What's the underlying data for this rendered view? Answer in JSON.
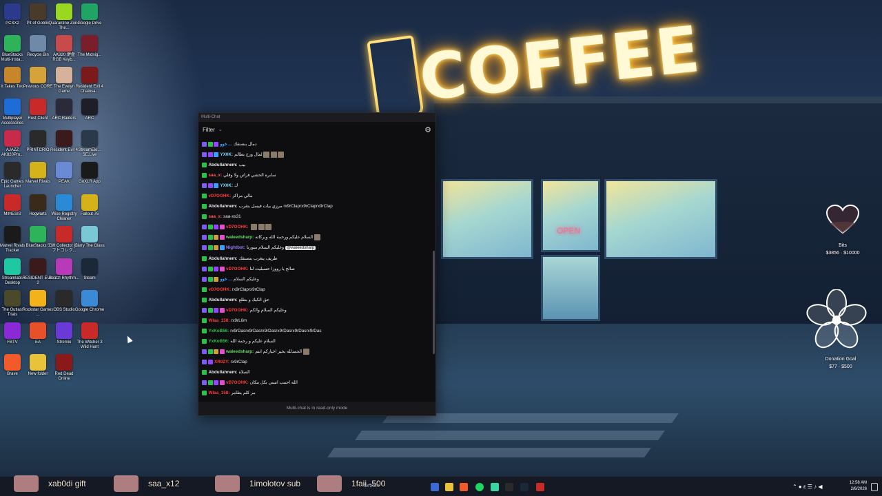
{
  "desktop_icons": [
    {
      "label": "PCSX2",
      "color": "#2b3a8c"
    },
    {
      "label": "Pit of Goblin",
      "color": "#4a3a2a"
    },
    {
      "label": "Quarantine Zone The...",
      "color": "#9ad81f"
    },
    {
      "label": "Google Drive",
      "color": "#1fa463"
    },
    {
      "label": "BlueStacks Multi-Insta...",
      "color": "#2fb35a"
    },
    {
      "label": "Recycle Bin",
      "color": "#6f8aa8"
    },
    {
      "label": "AK820 键盘 RGB Keyb...",
      "color": "#c84a4a"
    },
    {
      "label": "The Midnig...",
      "color": "#7a1f2a"
    },
    {
      "label": "It Takes Two",
      "color": "#c8862a"
    },
    {
      "label": "Previous CORE",
      "color": "#d6a23a"
    },
    {
      "label": "The Evelyn Game",
      "color": "#d6b29a"
    },
    {
      "label": "Resident Evil 4 Chainsa...",
      "color": "#7a1a1a"
    },
    {
      "label": "Multiplayer Accessories",
      "color": "#1e6cd6"
    },
    {
      "label": "Rust Client",
      "color": "#c82a2a"
    },
    {
      "label": "ARC Raiders",
      "color": "#2a2a3a"
    },
    {
      "label": "ARC",
      "color": "#1e1e28"
    },
    {
      "label": "AJAZZ AK820Pro...",
      "color": "#c82a4a"
    },
    {
      "label": "PRINTCRIO",
      "color": "#2a2a2a"
    },
    {
      "label": "Resident Evil 4",
      "color": "#3a1a1a"
    },
    {
      "label": "StreamEle... SE.Live",
      "color": "#2a3a4a"
    },
    {
      "label": "Epic Games Launcher",
      "color": "#2a2a2a"
    },
    {
      "label": "Marvel Rivals",
      "color": "#d6b21a"
    },
    {
      "label": "PEAK",
      "color": "#6a8ad6"
    },
    {
      "label": "GoXLR App",
      "color": "#1a1a1a"
    },
    {
      "label": "MIMESIS",
      "color": "#c82a2a"
    },
    {
      "label": "Hogwarts",
      "color": "#3a2a1a"
    },
    {
      "label": "Wise Registry Cleaner",
      "color": "#2a8ad6"
    },
    {
      "label": "Fallout 76",
      "color": "#d6b21a"
    },
    {
      "label": "Marvel Rivals Tracker",
      "color": "#1a1a1a"
    },
    {
      "label": "BlueStacks 5",
      "color": "#2fb35a"
    },
    {
      "label": "Gift Collector [ギフトコレク...",
      "color": "#c82a2a"
    },
    {
      "label": "Carry The Glass",
      "color": "#7ac8d6"
    },
    {
      "label": "Streamlabs Desktop",
      "color": "#1ec8a0"
    },
    {
      "label": "RESIDENT EVIL 2",
      "color": "#3a1a1a"
    },
    {
      "label": "Beatz! Rhythm...",
      "color": "#b83ab8"
    },
    {
      "label": "Steam",
      "color": "#1b2838"
    },
    {
      "label": "The Outlast Trials",
      "color": "#4a4a2a"
    },
    {
      "label": "Rockstar Games ...",
      "color": "#f2b21a"
    },
    {
      "label": "OBS Studio",
      "color": "#2a2a2a"
    },
    {
      "label": "Google Chrome",
      "color": "#3a8ad6"
    },
    {
      "label": "FBTV",
      "color": "#8a2ad6"
    },
    {
      "label": "EA",
      "color": "#e8502a"
    },
    {
      "label": "Stremio",
      "color": "#6a3ad6"
    },
    {
      "label": "The Witcher 3 Wild Hunt",
      "color": "#c82a2a"
    },
    {
      "label": "Brave",
      "color": "#f25a2a"
    },
    {
      "label": "New folder",
      "color": "#e8c23a"
    },
    {
      "label": "Red Dead Online",
      "color": "#8a1a1a"
    }
  ],
  "scene": {
    "sign_text": "COFFEE",
    "open_sign": "OPEN"
  },
  "chat": {
    "window_title": "Multi-Chat",
    "filter_label": "Filter",
    "chevron_icon": "chevron-down-icon",
    "settings_icon": "gear-icon",
    "footer": "Multi-chat is in read-only mode",
    "messages": [
      {
        "badges": [
          "mod",
          "kick",
          "sub"
        ],
        "user": "خوو ...",
        "user_color": "#3aa0ff",
        "text": "دمال بنصنقك"
      },
      {
        "badges": [
          "mod",
          "sub",
          "verify"
        ],
        "user": "YX0K:",
        "user_color": "#7cd6ff",
        "text": "لمال ورج بطالم",
        "emotes": 3
      },
      {
        "badges": [
          "kick"
        ],
        "user": "Abdullahnem:",
        "user_color": "#e8e8e8",
        "text": "بيب"
      },
      {
        "badges": [
          "kick"
        ],
        "user": "saa_x:",
        "user_color": "#ff5a5a",
        "text": "سابره الحشي فراتن ولا وقلي"
      },
      {
        "badges": [
          "mod",
          "sub",
          "verify"
        ],
        "user": "YX0K:",
        "user_color": "#7cd6ff",
        "text": "ك"
      },
      {
        "badges": [
          "kick"
        ],
        "user": "vD7OOHK:",
        "user_color": "#ff3a3a",
        "text": "مالي مراكز"
      },
      {
        "badges": [
          "kick"
        ],
        "user": "Abdullahnem:",
        "user_color": "#e8e8e8",
        "text": "مرزي بيات فيسل بتقرب rx9rClaprx9rClaprx9rClap"
      },
      {
        "badges": [
          "kick"
        ],
        "user": "saa_x:",
        "user_color": "#ff5a5a",
        "text": "saa-xs31"
      },
      {
        "badges": [
          "mod",
          "kick",
          "sub",
          "vip"
        ],
        "user": "vD7OOHK:",
        "user_color": "#ff3a3a",
        "text": "",
        "emotes": 3
      },
      {
        "badges": [
          "mod",
          "kick",
          "star",
          "vip"
        ],
        "user": "waleedsharp:",
        "user_color": "#6ad66a",
        "text": "السلام عليكم ورحمة الله وبركاته",
        "emotes": 1
      },
      {
        "badges": [
          "mod",
          "kick",
          "star",
          "verify"
        ],
        "user": "Nightbot:",
        "user_color": "#9b7cff",
        "text": "وعليكم السلام منورنا",
        "mention": "@waleedsharp"
      },
      {
        "badges": [
          "kick"
        ],
        "user": "Abdullahnem:",
        "user_color": "#e8e8e8",
        "text": "طريف يتغرب بنصنقك"
      },
      {
        "badges": [
          "mod",
          "kick",
          "sub",
          "vip"
        ],
        "user": "vD7OOHK:",
        "user_color": "#ff3a3a",
        "text": "صالح يا رووزا حسبليت لنا"
      },
      {
        "badges": [
          "mod",
          "kick",
          "star"
        ],
        "user": "خوو ...",
        "user_color": "#3aa0ff",
        "text": "وعليكم السلام"
      },
      {
        "badges": [
          "kick"
        ],
        "user": "vD7OOHK:",
        "user_color": "#ff3a3a",
        "text": "rx9rClaprx9rClap"
      },
      {
        "badges": [
          "kick"
        ],
        "user": "Abdullahnem:",
        "user_color": "#e8e8e8",
        "text": "حق الكيك و بطلع"
      },
      {
        "badges": [
          "mod",
          "kick",
          "sub",
          "vip"
        ],
        "user": "vD7OOHK:",
        "user_color": "#ff3a3a",
        "text": "وعليكم السلام والكم"
      },
      {
        "badges": [
          "kick"
        ],
        "user": "Wlaa_158:",
        "user_color": "#ff3a3a",
        "text": "rx9rL6m"
      },
      {
        "badges": [
          "kick"
        ],
        "user": "YxKoB56:",
        "user_color": "#27c24c",
        "text": "rx9rDasrx9rDasrx9rDasrx9rDasrx9rDasrx9rDas"
      },
      {
        "badges": [
          "kick"
        ],
        "user": "YxKoB56:",
        "user_color": "#27c24c",
        "text": "السلام عليكم و رحمة الله"
      },
      {
        "badges": [
          "mod",
          "kick",
          "star",
          "vip"
        ],
        "user": "waleedsharp:",
        "user_color": "#6ad66a",
        "text": "الحمدلله بخير اخباركم انتم",
        "emotes": 1
      },
      {
        "badges": [
          "mod",
          "sub"
        ],
        "user": "XR0ZY:",
        "user_color": "#ff3a3a",
        "text": "rx9rClap"
      },
      {
        "badges": [
          "kick"
        ],
        "user": "Abdullahnem:",
        "user_color": "#e8e8e8",
        "text": "الصلاة"
      },
      {
        "badges": [
          "mod",
          "kick",
          "sub",
          "vip"
        ],
        "user": "vD7OOHK:",
        "user_color": "#ff3a3a",
        "text": "الله احمب انسي بكل مكان"
      },
      {
        "badges": [
          "kick"
        ],
        "user": "Wlaa_158:",
        "user_color": "#ff3a3a",
        "text": "مر كلم بطامر"
      }
    ]
  },
  "widgets": {
    "bits_label": "Bits",
    "bits_value": "$3856 · $10000",
    "donation_label": "Donation Goal",
    "donation_value": "$77 · $500"
  },
  "alerts": [
    {
      "text": "xab0di gift"
    },
    {
      "text": "saa_x12"
    },
    {
      "text": "1imolotov sub"
    },
    {
      "text": "1faii -500"
    }
  ],
  "taskbar": {
    "search_placeholder": "Search",
    "time": "12:58 AM",
    "date": "2/6/2026"
  }
}
